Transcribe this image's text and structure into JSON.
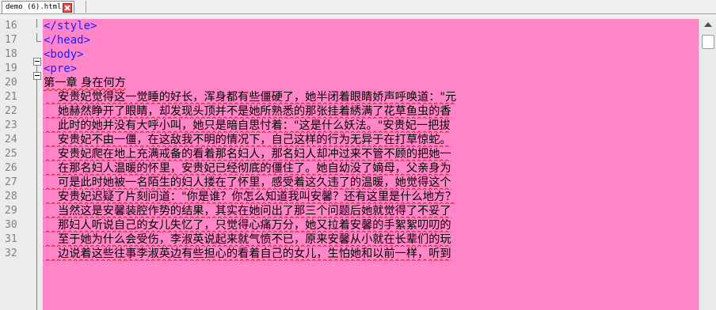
{
  "tab": {
    "label": "demo (6).html"
  },
  "lines": [
    {
      "num": "16",
      "kind": "code",
      "text": "</style>"
    },
    {
      "num": "17",
      "kind": "code",
      "text": "</head>"
    },
    {
      "num": "18",
      "kind": "code",
      "text": "<body>"
    },
    {
      "num": "19",
      "kind": "code",
      "text": "<pre>"
    },
    {
      "num": "20",
      "kind": "heading",
      "text": "第一章 身在何方"
    },
    {
      "num": "21",
      "kind": "text",
      "text": "    安贵妃觉得这一觉睡的好长，浑身都有些僵硬了，她半闭着眼睛娇声呼唤道：\"元"
    },
    {
      "num": "22",
      "kind": "text",
      "text": "    她赫然睁开了眼睛，却发现头顶并不是她所熟悉的那张挂着綉满了花草鱼虫的香"
    },
    {
      "num": "23",
      "kind": "text",
      "text": "    此时的她并没有大呼小叫，她只是暗自思忖着：\"这是什么妖法。\"安贵妃一把拔"
    },
    {
      "num": "24",
      "kind": "text",
      "text": "    安贵妃不由一僵，在这敌我不明的情况下，自己这样的行为无异于在打草惊蛇。"
    },
    {
      "num": "25",
      "kind": "text",
      "text": "    安贵妃爬在地上充满戒备的看着那名妇人，那名妇人却冲过来不管不顾的把她一"
    },
    {
      "num": "26",
      "kind": "text",
      "text": "    在那名妇人温暖的怀里，安贵妃已经彻底的僵住了。她自幼没了嫡母，父亲身为"
    },
    {
      "num": "27",
      "kind": "text",
      "text": "    可是此时她被一名陌生的妇人搂在了怀里，感受着这久违了的温暖，她觉得这个"
    },
    {
      "num": "28",
      "kind": "text",
      "text": "    安贵妃迟疑了片刻问道：\"你是谁？你怎么知道我叫安馨？还有这里是什么地方？"
    },
    {
      "num": "29",
      "kind": "text",
      "text": "    当然这是安馨装腔作势的结果，其实在她问出了那三个问题后她就觉得了不妥了"
    },
    {
      "num": "30",
      "kind": "text",
      "text": "    那妇人听说自己的女儿失忆了，只觉得心痛万分，她又拉着安馨的手絮絮叨叨的"
    },
    {
      "num": "31",
      "kind": "text",
      "text": "    至于她为什么会受伤，李淑英说起来就气愤不已，原来安馨从小就在长辈们的玩"
    },
    {
      "num": "32",
      "kind": "text",
      "text": "    边说着这些往事李淑英边有些担心的看着自己的女儿，生怕她和以前一样，听到"
    }
  ]
}
